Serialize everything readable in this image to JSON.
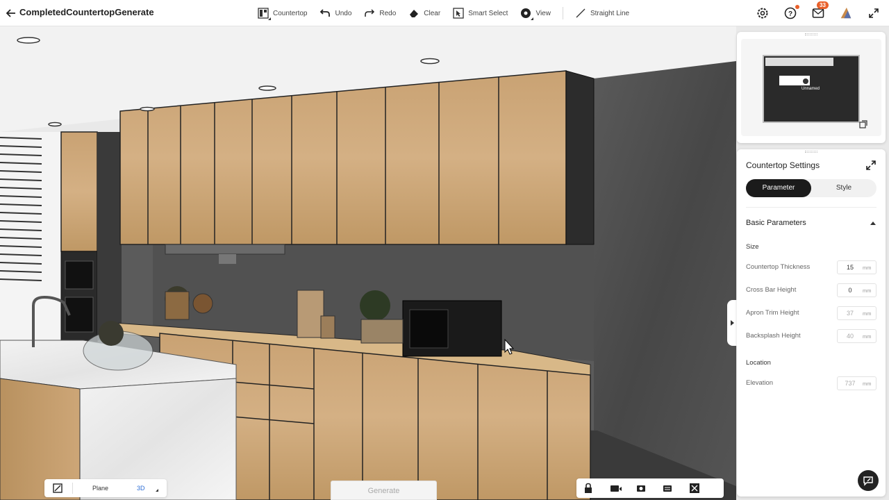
{
  "header": {
    "title": "CompletedCountertopGenerate"
  },
  "toolbar": {
    "countertop_label": "Countertop",
    "undo_label": "Undo",
    "redo_label": "Redo",
    "clear_label": "Clear",
    "smart_select_label": "Smart Select",
    "view_label": "View",
    "straight_line_label": "Straight Line",
    "messages_badge": "33"
  },
  "minimap": {
    "label": "Unnamed"
  },
  "settings": {
    "title": "Countertop Settings",
    "tabs": [
      "Parameter",
      "Style"
    ],
    "section_title": "Basic Parameters",
    "size_group": "Size",
    "location_group": "Location",
    "fields": [
      {
        "label": "Countertop Thickness",
        "value": "15",
        "unit": "mm"
      },
      {
        "label": "Cross Bar Height",
        "value": "0",
        "unit": "mm"
      },
      {
        "label": "Apron Trim Height",
        "value": "37",
        "unit": "mm"
      },
      {
        "label": "Backsplash Height",
        "value": "40",
        "unit": "mm"
      }
    ],
    "elevation": {
      "label": "Elevation",
      "value": "737",
      "unit": "mm"
    }
  },
  "bottom": {
    "plane_label": "Plane",
    "mode_label": "3D",
    "generate_label": "Generate"
  },
  "colors": {
    "accent_orange": "#e9602a",
    "wood": "#c9a576",
    "wall": "#4d4d4d",
    "active_tab": "#1b1b1b"
  }
}
